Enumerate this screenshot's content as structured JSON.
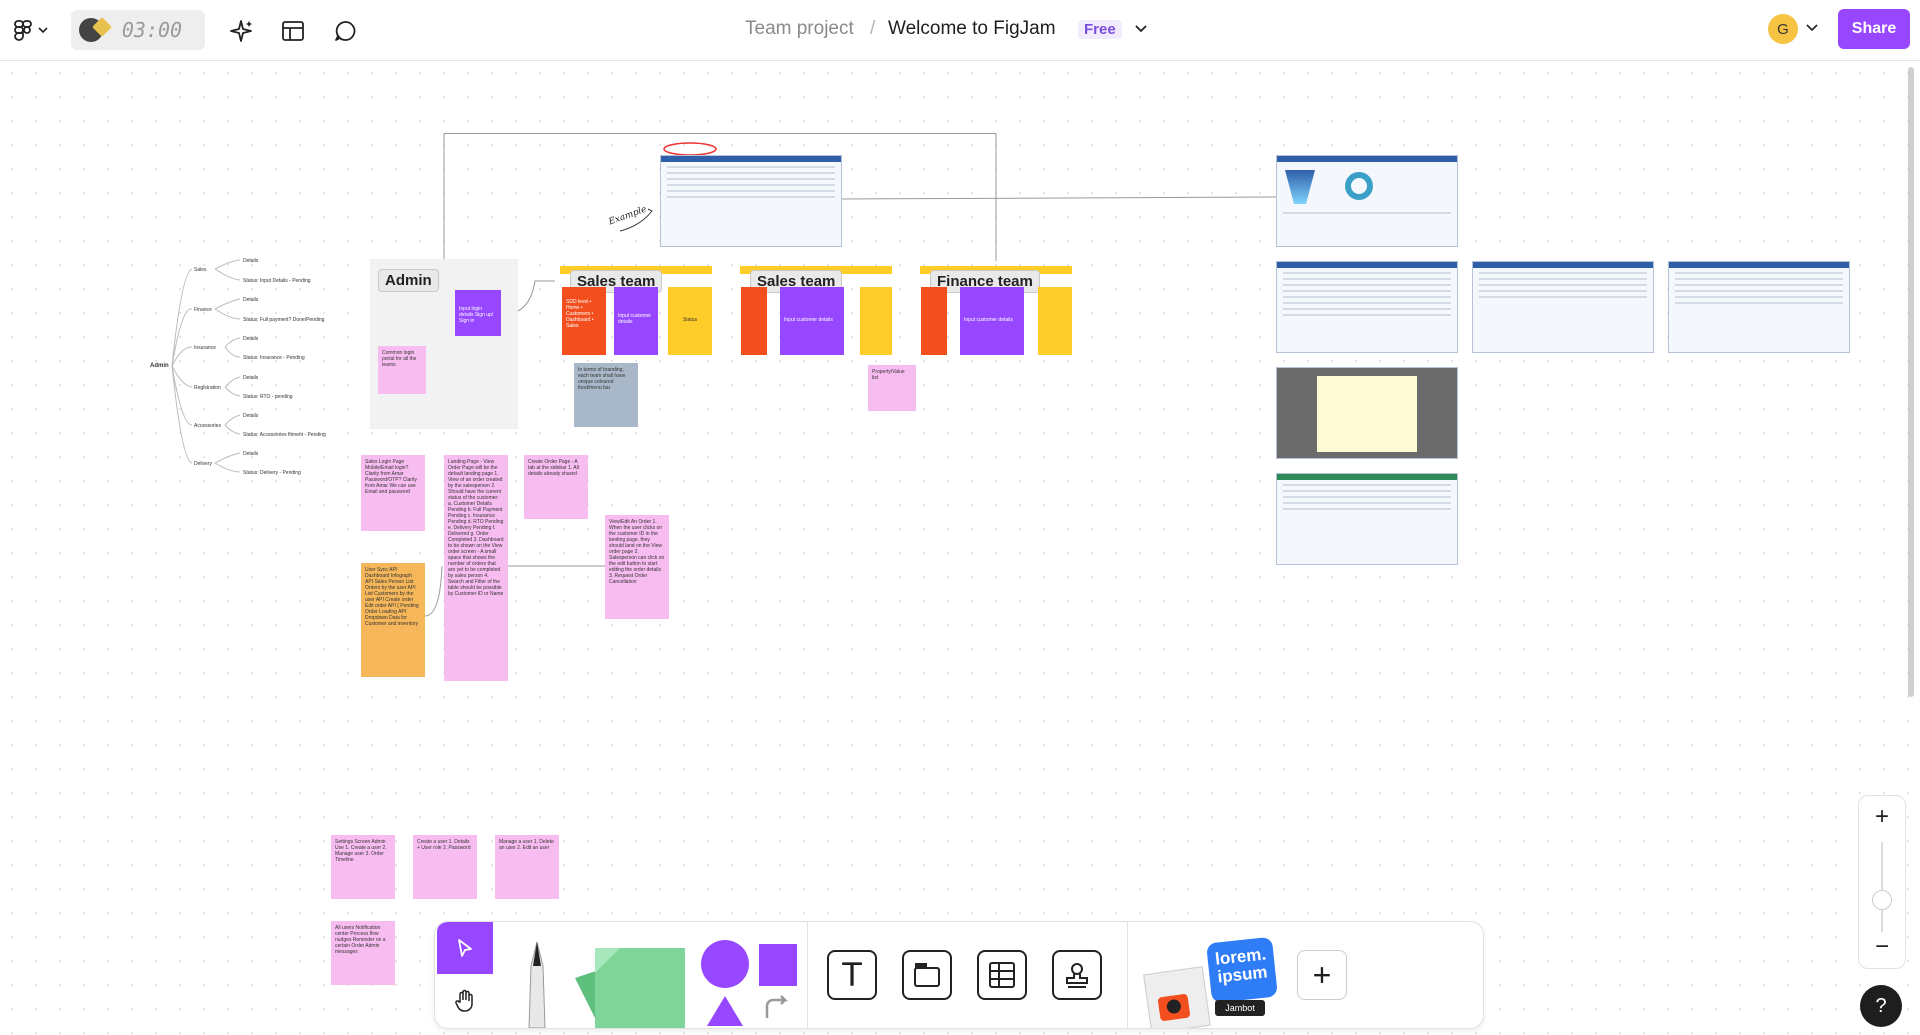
{
  "topbar": {
    "timer": "03:00",
    "project": "Team project",
    "separator": "/",
    "file_title": "Welcome to FigJam",
    "plan_badge": "Free",
    "avatar_initial": "G",
    "share_label": "Share"
  },
  "canvas": {
    "section_labels": [
      "Admin",
      "Sales team",
      "Sales team",
      "Finance team"
    ],
    "mindmap": {
      "root": "Admin",
      "branches": [
        {
          "label": "Sales",
          "leaves": [
            "Details",
            "Status: Input Details - Pending"
          ]
        },
        {
          "label": "Finance",
          "leaves": [
            "Details",
            "Status: Full payment? Done/Pending"
          ]
        },
        {
          "label": "Insurance",
          "leaves": [
            "Details",
            "Status: Insurance - Pending"
          ]
        },
        {
          "label": "Registration",
          "leaves": [
            "Details",
            "Status: RTO - pending"
          ]
        },
        {
          "label": "Accessories",
          "leaves": [
            "Details",
            "Status: Accessories fitment - Pending"
          ]
        },
        {
          "label": "Delivery",
          "leaves": [
            "Details",
            "Status: Delivery - Pending"
          ]
        }
      ]
    },
    "annotation": "Example",
    "stickies": {
      "admin_purple": "Input login details Sign up/ Sign in",
      "admin_pink": "Common login portal for all the teams",
      "sales_red": "SDD level • Home • Customers • Dashboard • Sales",
      "sales_purple": "Input customer details",
      "sales_yellow": "Status",
      "sales2_purple": "Input customer details",
      "finance_purple": "Input customer details",
      "branding_note": "In terms of branding, each team shall have unique coloured food/menu bar",
      "property_note": "Property/Value list",
      "sales_login": "Sales Login Page Mobile/Email login? Clarity from Amar Password/OTP? Clarity from Amar We can use Email and password",
      "landing_page": "Landing Page - View Order Page will be the default landing page 1. View of an order created by the salesperson 2. Should have the current status of the customer: a. Customer Details Pending b. Full Payment Pending c. Insurance Pending d. RTO Pending e. Delivery Pending f. Delivered g. Order Completed 3. Dashboard to be shown on the View order screen - A small space that shows the number of orders that are yet to be completed by sales person 4. Search and Filter of the table should be possible by Customer ID or Name",
      "create_order": "Create Order Page - A tab at the sidebar 1. All details already shared",
      "view_edit": "View/Edit An Order 1. When the user clicks on the customer ID in the landing page, they should land on the View order page 2. Salesperson can click on the edit button to start editing the order details 3. Request Order Cancellation",
      "user_sync": "User Sync API Dashboard Infograph API Sales Person List Orders by the user API List Customers by the user API Create order Edit order API ( Pending Order Loading API Dropdown Data for Customer and inventory",
      "settings": "Settings Screen Admin Use 1. Create a user 2. Manage user 3. Order Timeline",
      "create_user": "Create a user 1. Details + User role 2. Password",
      "manage_user": "Manage a user 1. Delete an user 2. Edit an user",
      "notification": "All users Notification center Process flow nudges Reminder on a certain Order Admin messages"
    }
  },
  "zoom": {
    "zoom_in": "+",
    "zoom_out": "−"
  },
  "help": "?",
  "toolbar": {
    "text_tool": "T",
    "sticker_line1": "lorem.",
    "sticker_line2": "ipsum",
    "jambot": "Jambot",
    "more": "+"
  },
  "colors": {
    "accent": "#9747ff",
    "sticky_pink": "#f8bdf0",
    "sticky_orange": "#f6b75b",
    "red": "#f24e1e",
    "yellow": "#ffcd29",
    "green": "#7fd49a"
  }
}
